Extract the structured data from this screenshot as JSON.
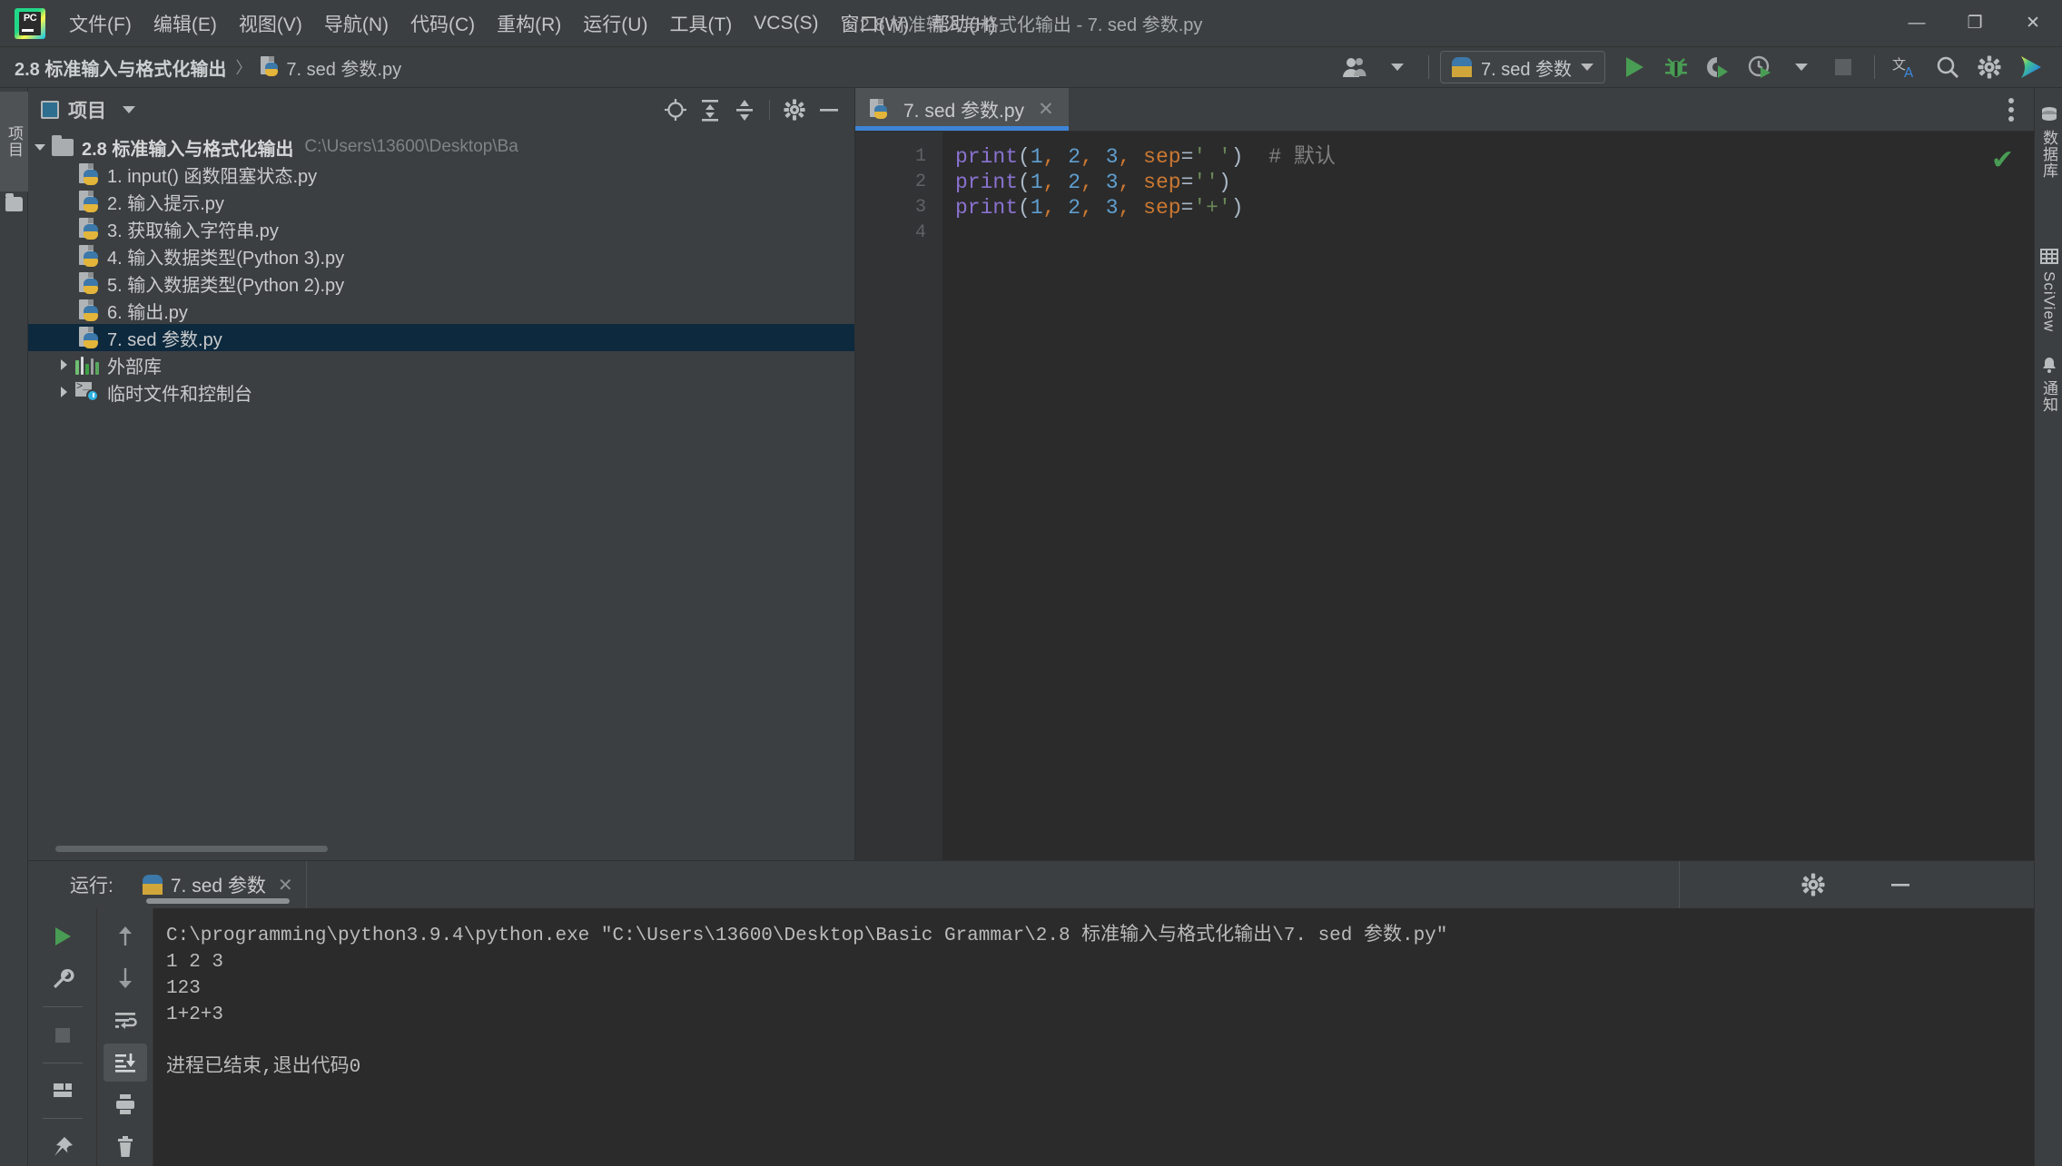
{
  "window": {
    "title": "2.8 标准输入与格式化输出 - 7. sed 参数.py",
    "minimize": "—",
    "maximize": "❐",
    "close": "✕"
  },
  "menubar": {
    "items": [
      {
        "label": "文件(F)"
      },
      {
        "label": "编辑(E)"
      },
      {
        "label": "视图(V)"
      },
      {
        "label": "导航(N)"
      },
      {
        "label": "代码(C)"
      },
      {
        "label": "重构(R)"
      },
      {
        "label": "运行(U)"
      },
      {
        "label": "工具(T)"
      },
      {
        "label": "VCS(S)"
      },
      {
        "label": "窗口(W)"
      },
      {
        "label": "帮助(H)"
      }
    ]
  },
  "navbar": {
    "breadcrumb": {
      "project": "2.8 标准输入与格式化输出",
      "separator": "〉",
      "file": "7. sed 参数.py"
    },
    "run_config": {
      "name": "7. sed 参数"
    },
    "icons": {
      "user": "user-icon",
      "run": "run-icon",
      "debug": "debug-icon",
      "coverage": "coverage-icon",
      "profile": "profile-icon",
      "stop": "stop-icon",
      "translate": "translate-icon",
      "search": "search-icon",
      "settings": "settings-icon",
      "rainbow": "rainbow-icon"
    }
  },
  "left_strip": {
    "project_tab": "项目",
    "folder_icon": "folder-icon"
  },
  "right_strip": {
    "items": [
      {
        "label": "数据库",
        "icon": "database-icon"
      },
      {
        "label": "SciView",
        "icon": "grid-icon"
      },
      {
        "label": "通知",
        "icon": "bell-icon"
      }
    ]
  },
  "project_panel": {
    "title": "项目",
    "dropdown": "▾",
    "tools": [
      "locate-icon",
      "expand-all-icon",
      "collapse-all-icon",
      "gear-icon",
      "hide-icon"
    ],
    "tree": [
      {
        "label": "2.8 标准输入与格式化输出",
        "path": "C:\\Users\\13600\\Desktop\\Ba",
        "type": "folder",
        "indent": 0,
        "arrow": "down",
        "bold": true,
        "selected": false
      },
      {
        "label": "1. input() 函数阻塞状态.py",
        "type": "py",
        "indent": 1,
        "arrow": "none",
        "selected": false
      },
      {
        "label": "2. 输入提示.py",
        "type": "py",
        "indent": 1,
        "arrow": "none",
        "selected": false
      },
      {
        "label": "3. 获取输入字符串.py",
        "type": "py",
        "indent": 1,
        "arrow": "none",
        "selected": false
      },
      {
        "label": "4. 输入数据类型(Python 3).py",
        "type": "py",
        "indent": 1,
        "arrow": "none",
        "selected": false
      },
      {
        "label": "5. 输入数据类型(Python 2).py",
        "type": "py",
        "indent": 1,
        "arrow": "none",
        "selected": false
      },
      {
        "label": "6. 输出.py",
        "type": "py",
        "indent": 1,
        "arrow": "none",
        "selected": false
      },
      {
        "label": "7. sed 参数.py",
        "type": "py",
        "indent": 1,
        "arrow": "none",
        "selected": true
      },
      {
        "label": "外部库",
        "type": "lib",
        "indent": 0,
        "arrow": "right",
        "selected": false
      },
      {
        "label": "临时文件和控制台",
        "type": "scratch",
        "indent": 0,
        "arrow": "right",
        "selected": false
      }
    ]
  },
  "editor": {
    "tab": {
      "label": "7. sed 参数.py",
      "close": "✕",
      "icon": "python-file-icon"
    },
    "kebab": "more-options-icon",
    "inspection_status": "✔",
    "line_numbers": [
      "1",
      "2",
      "3",
      "4"
    ],
    "code": [
      {
        "tokens": [
          {
            "t": "print",
            "c": "k-fn"
          },
          {
            "t": "(",
            "c": "k-punc"
          },
          {
            "t": "1",
            "c": "k-num"
          },
          {
            "t": ",",
            "c": "k-comma"
          },
          {
            "t": " ",
            "c": "k-punc"
          },
          {
            "t": "2",
            "c": "k-num"
          },
          {
            "t": ",",
            "c": "k-comma"
          },
          {
            "t": " ",
            "c": "k-punc"
          },
          {
            "t": "3",
            "c": "k-num"
          },
          {
            "t": ",",
            "c": "k-comma"
          },
          {
            "t": " ",
            "c": "k-punc"
          },
          {
            "t": "sep",
            "c": "k-param"
          },
          {
            "t": "=",
            "c": "k-punc"
          },
          {
            "t": "' '",
            "c": "k-str"
          },
          {
            "t": ")",
            "c": "k-punc"
          },
          {
            "t": "  ",
            "c": "k-punc"
          },
          {
            "t": "# 默认",
            "c": "k-comment"
          }
        ]
      },
      {
        "tokens": [
          {
            "t": "print",
            "c": "k-fn"
          },
          {
            "t": "(",
            "c": "k-punc"
          },
          {
            "t": "1",
            "c": "k-num"
          },
          {
            "t": ",",
            "c": "k-comma"
          },
          {
            "t": " ",
            "c": "k-punc"
          },
          {
            "t": "2",
            "c": "k-num"
          },
          {
            "t": ",",
            "c": "k-comma"
          },
          {
            "t": " ",
            "c": "k-punc"
          },
          {
            "t": "3",
            "c": "k-num"
          },
          {
            "t": ",",
            "c": "k-comma"
          },
          {
            "t": " ",
            "c": "k-punc"
          },
          {
            "t": "sep",
            "c": "k-param"
          },
          {
            "t": "=",
            "c": "k-punc"
          },
          {
            "t": "''",
            "c": "k-str"
          },
          {
            "t": ")",
            "c": "k-punc"
          }
        ]
      },
      {
        "tokens": [
          {
            "t": "print",
            "c": "k-fn"
          },
          {
            "t": "(",
            "c": "k-punc"
          },
          {
            "t": "1",
            "c": "k-num"
          },
          {
            "t": ",",
            "c": "k-comma"
          },
          {
            "t": " ",
            "c": "k-punc"
          },
          {
            "t": "2",
            "c": "k-num"
          },
          {
            "t": ",",
            "c": "k-comma"
          },
          {
            "t": " ",
            "c": "k-punc"
          },
          {
            "t": "3",
            "c": "k-num"
          },
          {
            "t": ",",
            "c": "k-comma"
          },
          {
            "t": " ",
            "c": "k-punc"
          },
          {
            "t": "sep",
            "c": "k-param"
          },
          {
            "t": "=",
            "c": "k-punc"
          },
          {
            "t": "'+'",
            "c": "k-str"
          },
          {
            "t": ")",
            "c": "k-punc"
          }
        ]
      },
      {
        "tokens": []
      }
    ]
  },
  "run_panel": {
    "label": "运行:",
    "tab": {
      "label": "7. sed 参数",
      "close": "✕",
      "icon": "python-icon"
    },
    "right_icons": [
      "gear-icon",
      "hide-icon"
    ],
    "tools_left": [
      "rerun-icon",
      "wrench-icon",
      "stop-icon",
      "layout-icon",
      "pin-icon"
    ],
    "tools_right": [
      "up-arrow-icon",
      "down-arrow-icon",
      "soft-wrap-icon",
      "scroll-to-end-icon",
      "print-icon",
      "trash-icon"
    ],
    "console": [
      "C:\\programming\\python3.9.4\\python.exe \"C:\\Users\\13600\\Desktop\\Basic Grammar\\2.8 标准输入与格式化输出\\7. sed 参数.py\"",
      "1 2 3",
      "123",
      "1+2+3",
      "",
      "进程已结束,退出代码0"
    ]
  },
  "colors": {
    "accent": "#3d84d6",
    "selection": "#0d293e",
    "run_green": "#499c54",
    "panel_bg": "#3c3f41",
    "editor_bg": "#2b2b2b"
  }
}
